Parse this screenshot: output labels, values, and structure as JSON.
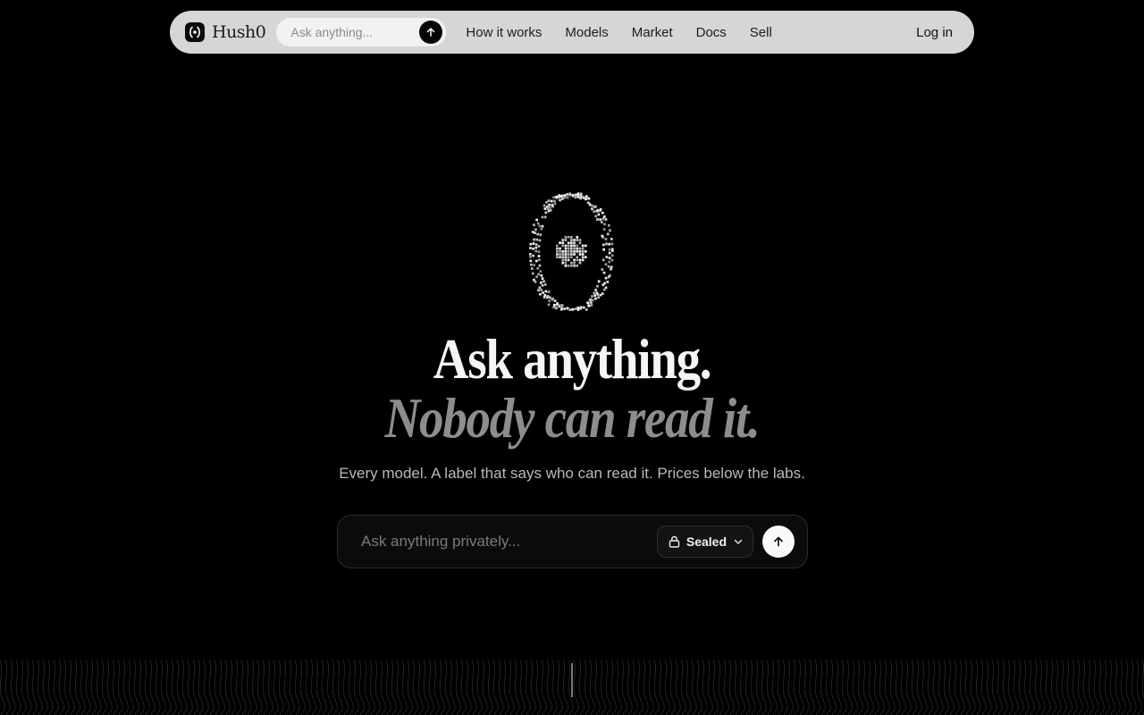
{
  "brand": {
    "name": "Hush0"
  },
  "nav": {
    "search_placeholder": "Ask anything...",
    "links": [
      {
        "label": "How it works"
      },
      {
        "label": "Models"
      },
      {
        "label": "Market"
      },
      {
        "label": "Docs"
      },
      {
        "label": "Sell"
      }
    ],
    "login_label": "Log in"
  },
  "hero": {
    "headline_line1": "Ask anything.",
    "headline_line2": "Nobody can read it.",
    "subtitle": "Every model. A label that says who can read it. Prices below the labs."
  },
  "prompt": {
    "placeholder": "Ask anything privately...",
    "mode_label": "Sealed"
  },
  "icons": {
    "brand": "brand-logo-icon",
    "nav_send": "arrow-up-icon",
    "mode": "lock-icon",
    "mode_chevron": "chevron-down-icon",
    "send": "arrow-up-icon"
  },
  "colors": {
    "background": "#000000",
    "navbar": "#d6d6d6",
    "headline_primary": "#f5f5f5",
    "headline_secondary": "#8d8d8d"
  }
}
